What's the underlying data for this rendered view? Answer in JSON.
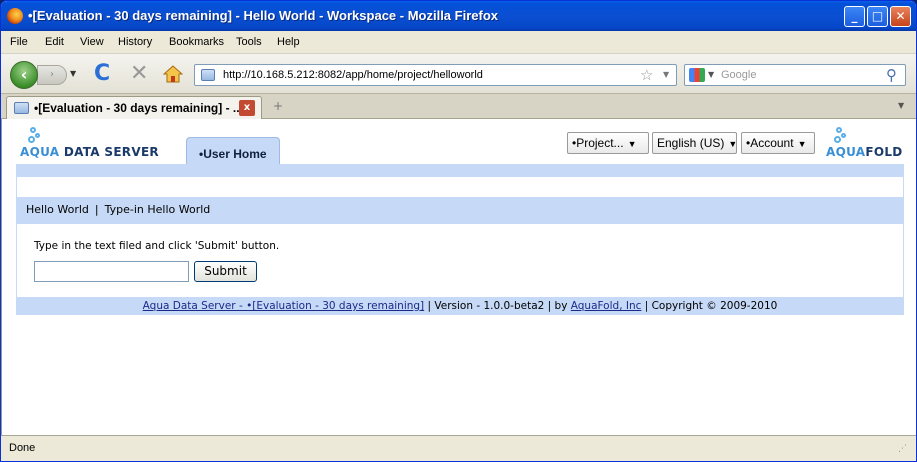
{
  "window": {
    "title": "•[Evaluation - 30 days remaining] - Hello World - Workspace - Mozilla Firefox",
    "min_glyph": "_",
    "max_glyph": "□",
    "close_glyph": "✕"
  },
  "menubar": {
    "items": [
      {
        "label": "File"
      },
      {
        "label": "Edit"
      },
      {
        "label": "View"
      },
      {
        "label": "History"
      },
      {
        "label": "Bookmarks"
      },
      {
        "label": "Tools"
      },
      {
        "label": "Help"
      }
    ]
  },
  "navbar": {
    "back_glyph": "‹",
    "forward_glyph": "›",
    "dropdown_glyph": "▼",
    "reload_glyph": "C",
    "stop_glyph": "✕",
    "url": "http://10.168.5.212:8082/app/home/project/helloworld",
    "star_glyph": "☆",
    "search_placeholder": "Google",
    "search_glyph": "⚲",
    "accent_color": "#2b6fd6"
  },
  "tabbar": {
    "tab_label": "•[Evaluation - 30 days remaining] - ...",
    "close_glyph": "x",
    "newtab_glyph": "+",
    "list_glyph": "▼"
  },
  "app": {
    "logo_left": {
      "prefix": "AQUA",
      "suffix": " DATA SERVER"
    },
    "logo_right": {
      "prefix": "AQUA",
      "suffix": "FOLD"
    },
    "user_tab": "•User Home",
    "dropdowns": {
      "project": "•Project...",
      "language": "English (US)",
      "account": "•Account",
      "arrow": "▼"
    },
    "breadcrumb": {
      "first": "Hello World",
      "separator": "|",
      "second": "Type-in Hello World"
    },
    "instructions": "Type in the text filed and click 'Submit' button.",
    "input_value": "",
    "submit_label": "Submit",
    "footer": {
      "link1": "Aqua Data Server - •[Evaluation - 30 days remaining]",
      "sep1": " | Version - 1.0.0-beta2 | by ",
      "link2": "AquaFold, Inc",
      "sep2": " | Copyright © 2009-2010"
    },
    "theme_color": "#c6d9f6"
  },
  "statusbar": {
    "text": "Done",
    "grip_glyph": "⋰"
  }
}
